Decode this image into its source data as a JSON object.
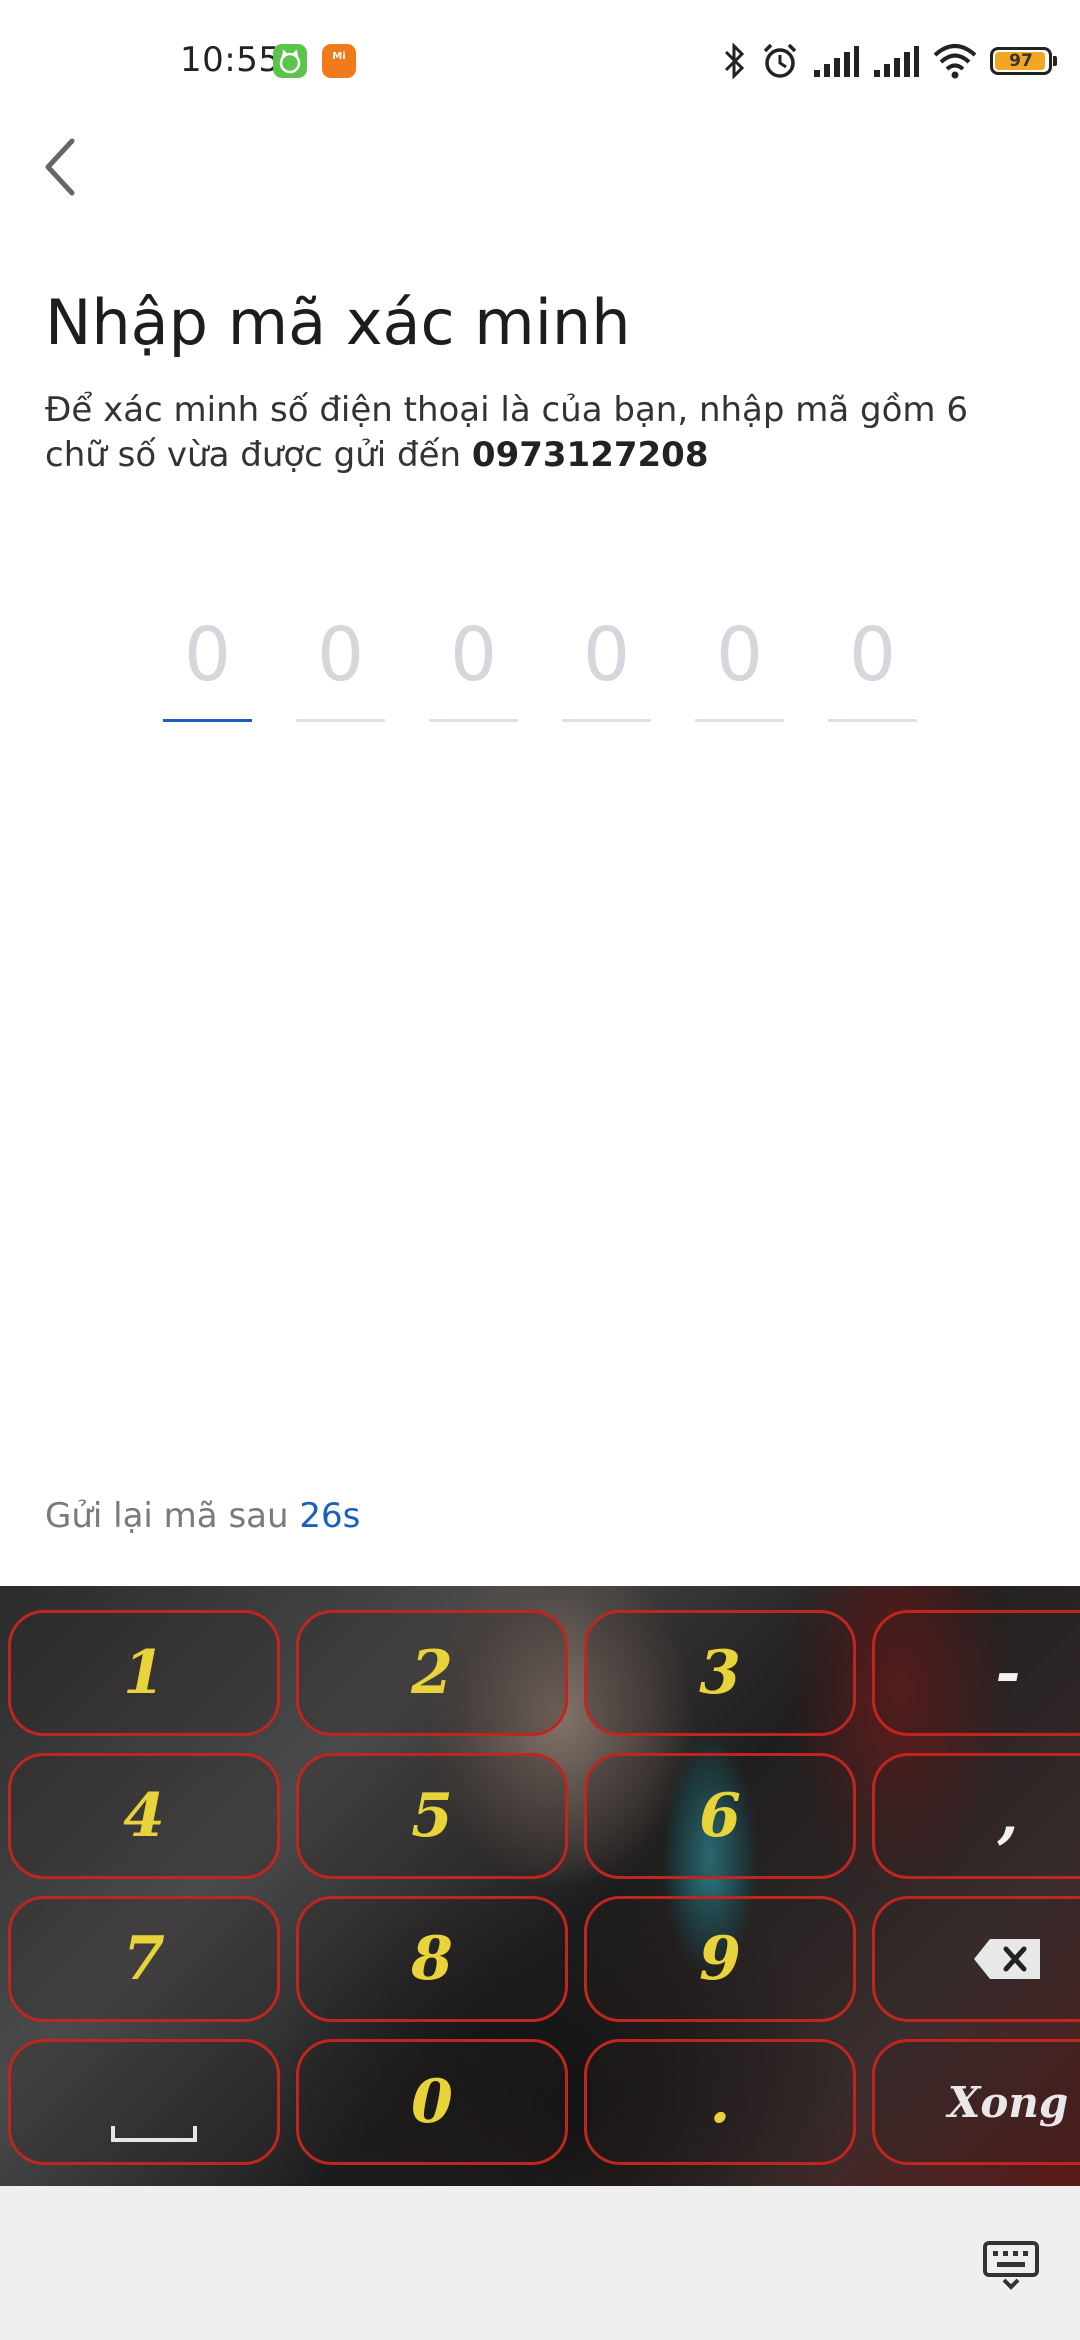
{
  "status": {
    "time": "10:55",
    "battery": "97",
    "app_icons": [
      "cat-app-icon",
      "mi-app-icon"
    ],
    "mi_label": "Mi"
  },
  "page": {
    "title": "Nhập mã xác minh",
    "subtitle": "Để xác minh số điện thoại là của bạn, nhập mã gồm 6 chữ số vừa được gửi đến ",
    "phone": "0973127208"
  },
  "otp": {
    "placeholders": [
      "0",
      "0",
      "0",
      "0",
      "0",
      "0"
    ],
    "active_index": 0,
    "active_color": "#1a5fc0"
  },
  "resend": {
    "label": "Gửi lại mã sau ",
    "countdown": "26s"
  },
  "keyboard": {
    "keys": [
      "1",
      "2",
      "3",
      "-",
      "4",
      "5",
      "6",
      ",",
      "7",
      "8",
      "9",
      "delete",
      "space",
      "0",
      ".",
      "Xong"
    ],
    "done_label": "Xong",
    "key_border_color": "#c0261e",
    "key_text_color": "#e8d43a"
  },
  "navbar": {
    "icon": "keyboard-toggle-icon"
  }
}
